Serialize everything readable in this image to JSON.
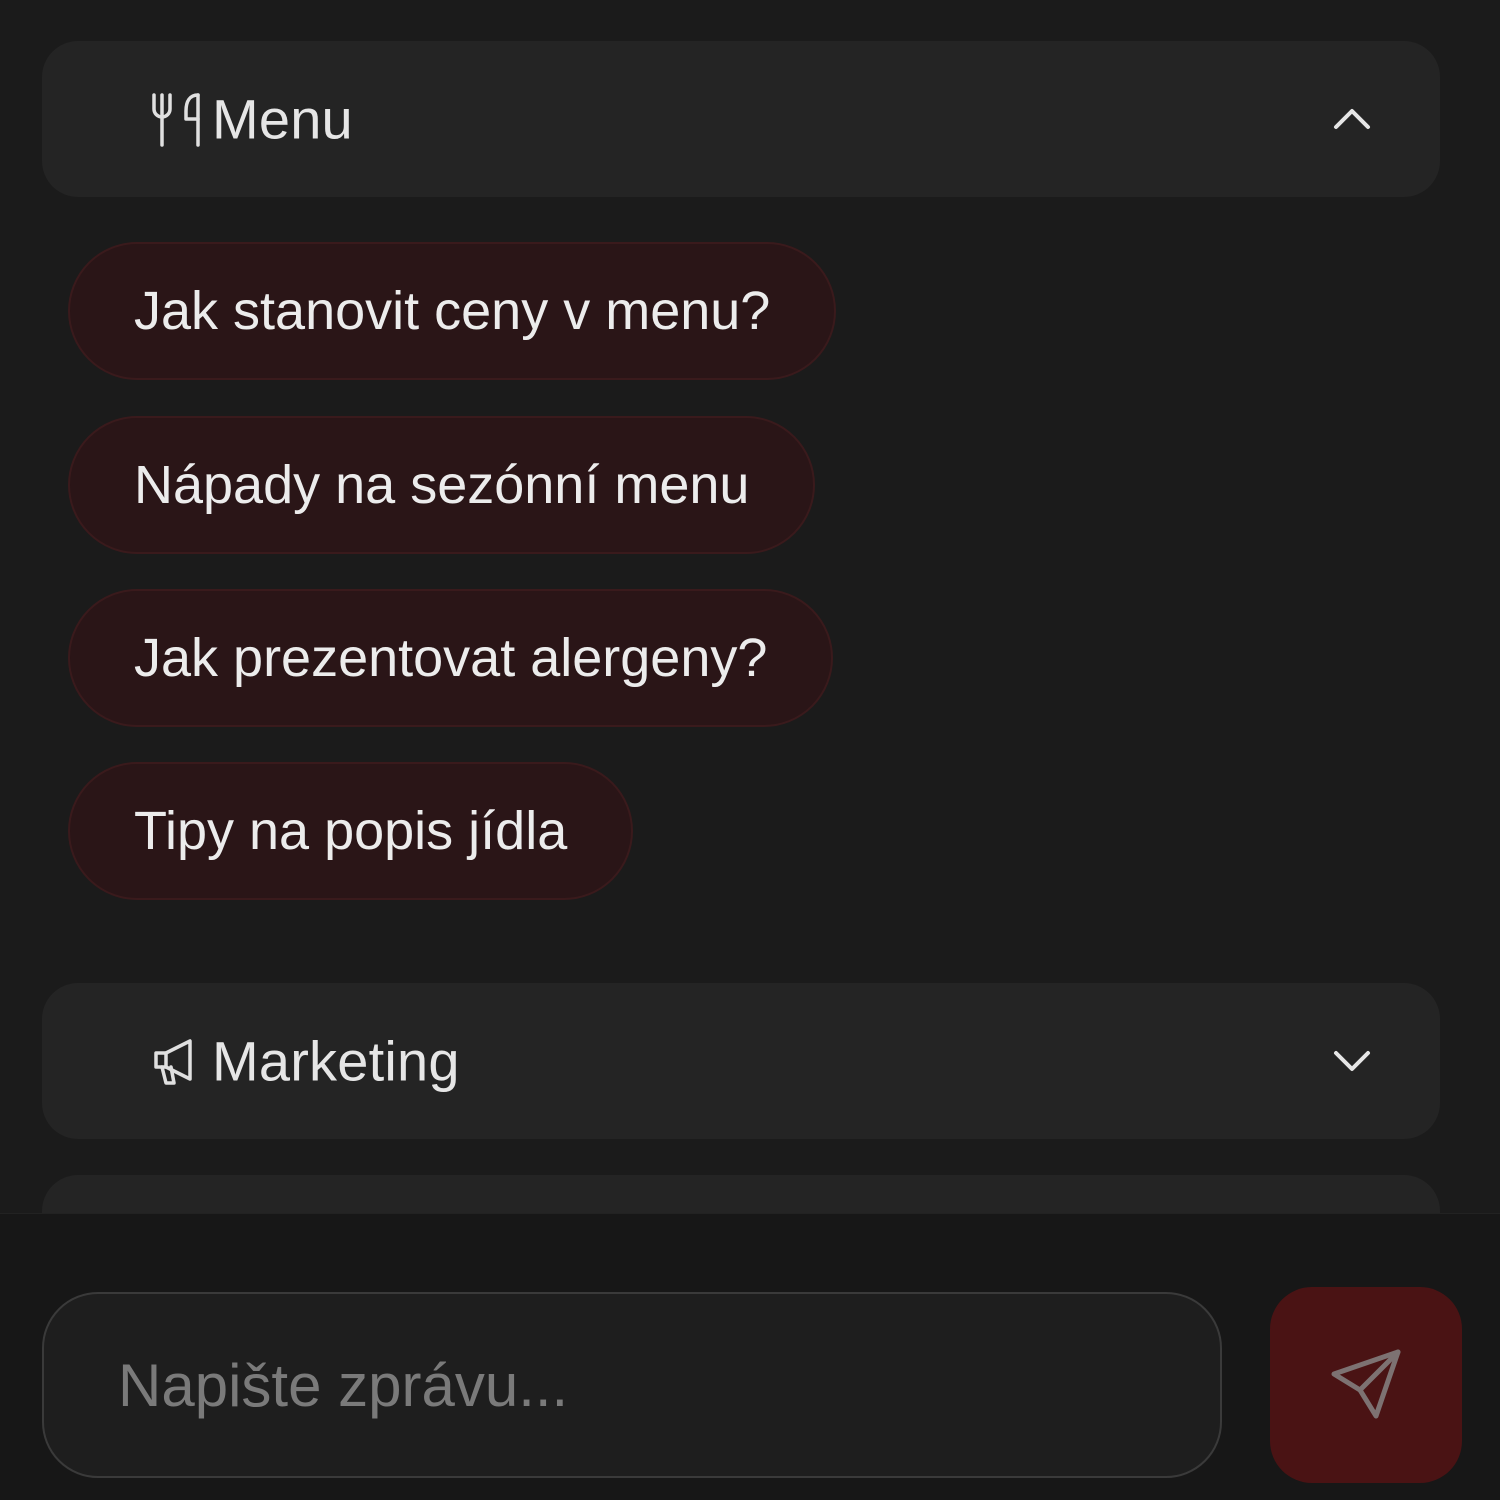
{
  "sections": [
    {
      "title": "Menu",
      "icon": "utensils-icon",
      "expanded": true
    },
    {
      "title": "Marketing",
      "icon": "megaphone-icon",
      "expanded": false
    }
  ],
  "chips": [
    {
      "label": "Jak stanovit ceny v menu?"
    },
    {
      "label": "Nápady na sezónní menu"
    },
    {
      "label": "Jak prezentovat alergeny?"
    },
    {
      "label": "Tipy na popis jídla"
    }
  ],
  "composer": {
    "placeholder": "Napište zprávu...",
    "send_icon": "send-icon"
  },
  "colors": {
    "background": "#1b1b1b",
    "section_bg": "#242424",
    "chip_bg": "#2a1517",
    "chip_border": "#3a1a1c",
    "send_bg": "#4a1314"
  }
}
